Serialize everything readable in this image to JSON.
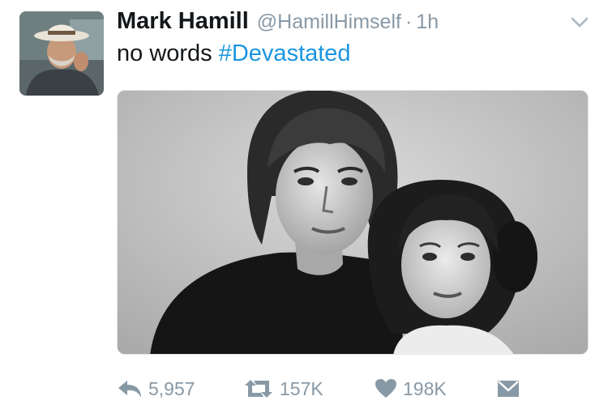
{
  "tweet": {
    "author": {
      "name": "Mark Hamill",
      "handle": "@HamillHimself",
      "separator": "·",
      "time": "1h"
    },
    "text": "no words ",
    "hashtag": "#Devastated",
    "media_alt": "Black and white photo of Luke Skywalker and Princess Leia",
    "actions": {
      "reply_count": "5,957",
      "retweet_count": "157K",
      "like_count": "198K"
    }
  },
  "icons": {
    "caret": "chevron-down-icon",
    "reply": "reply-icon",
    "retweet": "retweet-icon",
    "like": "heart-icon",
    "dm": "envelope-icon"
  },
  "colors": {
    "name": "#14171a",
    "muted": "#8899a6",
    "link": "#1b95e0"
  }
}
